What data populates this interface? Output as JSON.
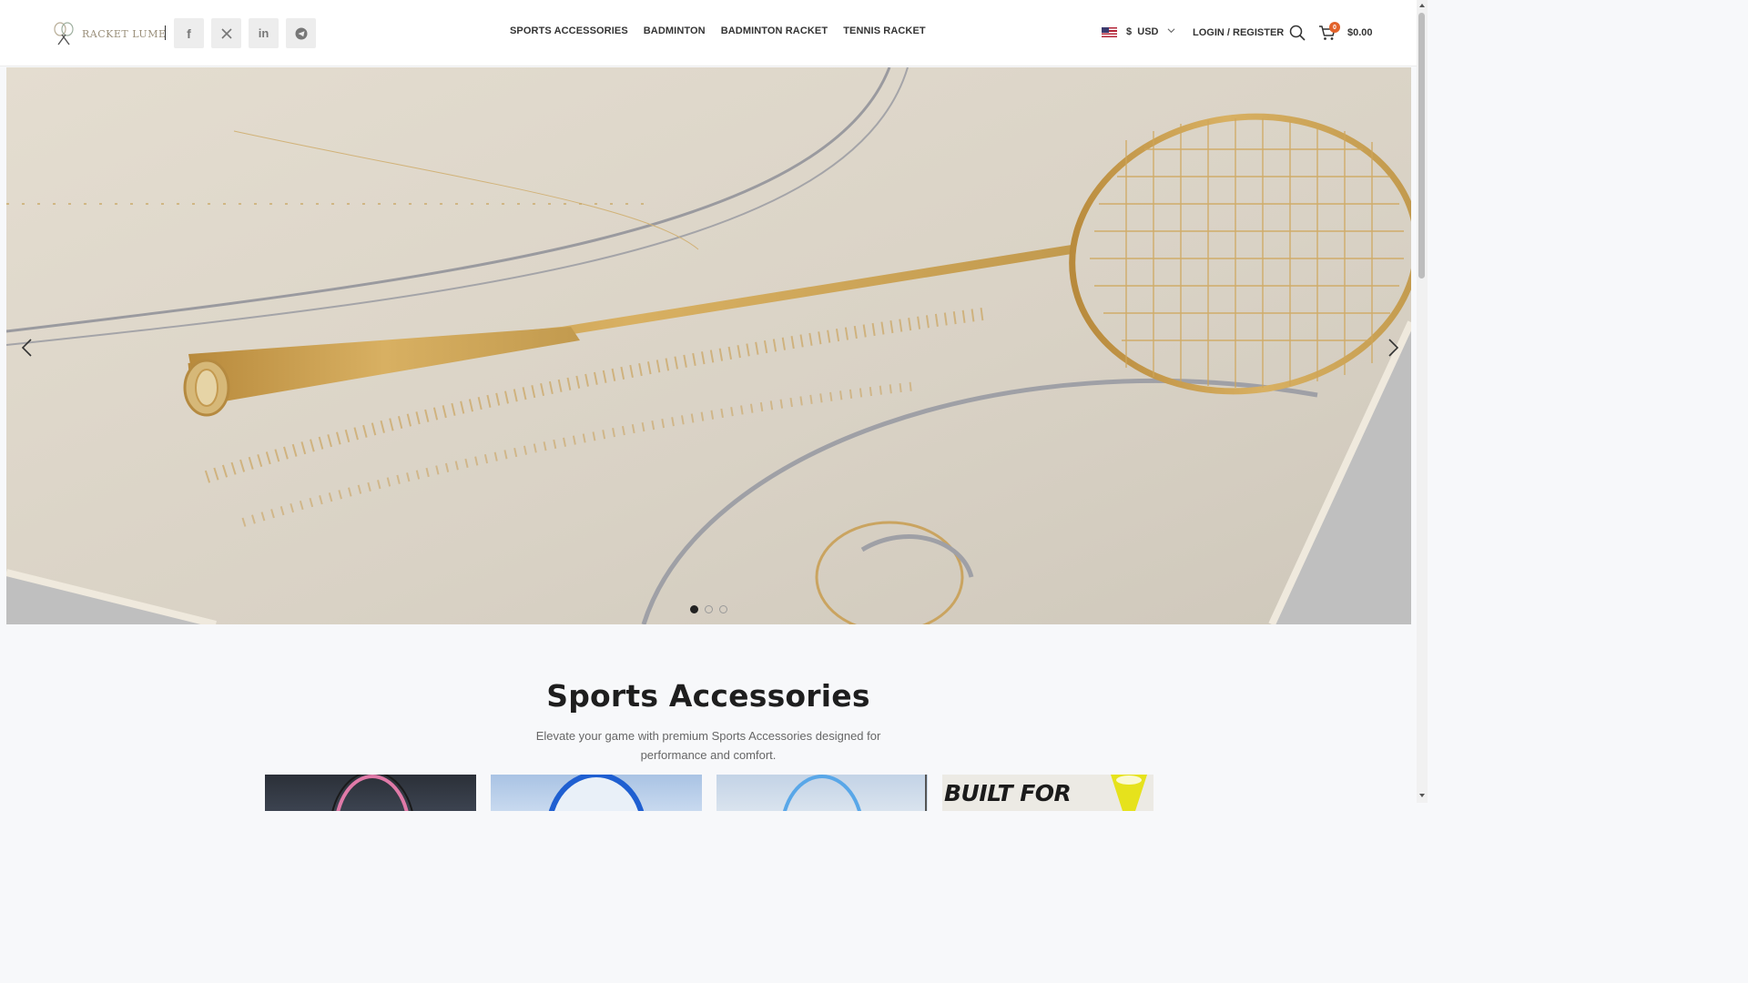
{
  "header": {
    "logo_text": "RACKET LUME",
    "socials": [
      {
        "name": "facebook",
        "icon": "facebook-icon",
        "glyph": "f"
      },
      {
        "name": "x",
        "icon": "x-icon",
        "glyph": "𝕏"
      },
      {
        "name": "linkedin",
        "icon": "linkedin-icon",
        "glyph": "in"
      },
      {
        "name": "telegram",
        "icon": "telegram-icon",
        "glyph": ""
      }
    ],
    "nav": [
      "SPORTS ACCESSORIES",
      "BADMINTON",
      "BADMINTON RACKET",
      "TENNIS RACKET"
    ],
    "currency": {
      "symbol": "$",
      "code": "USD"
    },
    "login_label": "LOGIN / REGISTER",
    "cart": {
      "count": "0",
      "total": "$0.00"
    }
  },
  "hero": {
    "slides": 3,
    "active_slide": 1
  },
  "section": {
    "title": "Sports Accessories",
    "subtitle": "Elevate your game with premium Sports Accessories designed for performance and comfort.",
    "tiles": [
      {
        "name": "tile-pink-racket"
      },
      {
        "name": "tile-blue-racket"
      },
      {
        "name": "tile-light-blue-racket"
      },
      {
        "name": "tile-built-for",
        "text": "BUILT FOR"
      }
    ]
  },
  "colors": {
    "accent": "#e2622a",
    "gold": "#c9a35a",
    "hero_bg": "#d8d3c9"
  }
}
